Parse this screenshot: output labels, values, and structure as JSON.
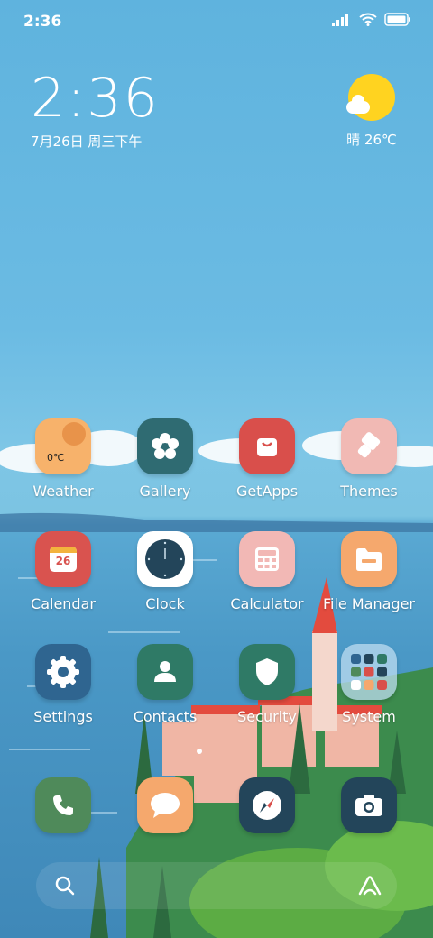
{
  "status": {
    "time": "2:36"
  },
  "clock_widget": {
    "time": "2:36",
    "date": "7月26日 周三下午"
  },
  "weather_widget": {
    "icon": "sunny-cloud-icon",
    "text": "晴 26℃"
  },
  "apps": [
    {
      "label": "Weather",
      "icon": "weather-icon",
      "badge": "0℃",
      "color": "#f7b26b"
    },
    {
      "label": "Gallery",
      "icon": "gallery-icon",
      "color": "#2f6b72"
    },
    {
      "label": "GetApps",
      "icon": "getapps-icon",
      "color": "#d94f4b"
    },
    {
      "label": "Themes",
      "icon": "themes-icon",
      "color": "#f1b9b4"
    },
    {
      "label": "Calendar",
      "icon": "calendar-icon",
      "badge": "26",
      "color": "#d9534f"
    },
    {
      "label": "Clock",
      "icon": "clock-icon",
      "color": "#ffffff"
    },
    {
      "label": "Calculator",
      "icon": "calculator-icon",
      "color": "#f2b8b5"
    },
    {
      "label": "File Manager",
      "icon": "folder-icon",
      "color": "#f5a86d"
    },
    {
      "label": "Settings",
      "icon": "settings-icon",
      "color": "#2f6590"
    },
    {
      "label": "Contacts",
      "icon": "contacts-icon",
      "color": "#2f7a66"
    },
    {
      "label": "Security",
      "icon": "security-icon",
      "color": "#2f7a66"
    },
    {
      "label": "System",
      "icon": "folder-system-icon",
      "color": "#a9cde4"
    }
  ],
  "dock": [
    {
      "name": "phone",
      "icon": "phone-icon",
      "color": "#4f8a5a"
    },
    {
      "name": "messages",
      "icon": "messages-icon",
      "color": "#f5a86d"
    },
    {
      "name": "browser",
      "icon": "compass-icon",
      "color": "#23455a"
    },
    {
      "name": "camera",
      "icon": "camera-icon",
      "color": "#23455a"
    }
  ],
  "bottom_bar": {
    "left_icon": "search-icon",
    "right_icon": "assistant-icon"
  }
}
